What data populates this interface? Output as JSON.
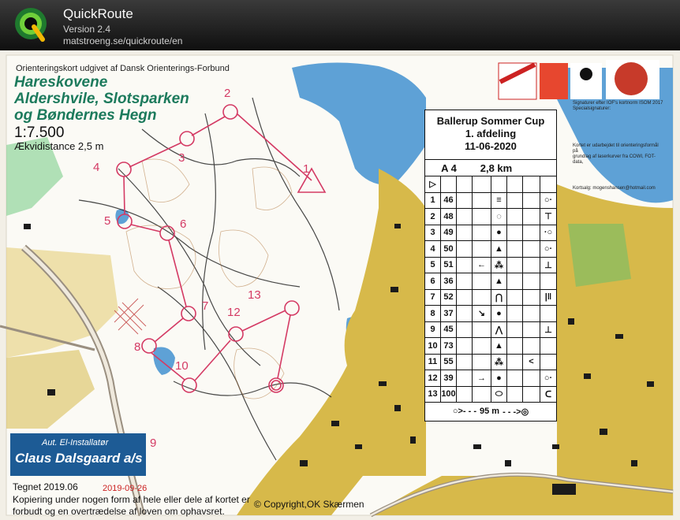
{
  "app": {
    "name": "QuickRoute",
    "version": "Version 2.4",
    "url": "matstroeng.se/quickroute/en",
    "logo_letter": "Q"
  },
  "map": {
    "publisher": "Orienteringskort udgivet af Dansk Orienterings-Forbund",
    "title_lines": [
      "Hareskovene",
      "Aldershvile, Slotsparken",
      "og Bøndernes Hegn"
    ],
    "scale": "1:7.500",
    "contour": "Ækvidistance 2,5 m",
    "control_numbers": [
      "2",
      "3",
      "4",
      "5",
      "6",
      "7",
      "8",
      "9",
      "10",
      "12",
      "13",
      "1"
    ],
    "description_card": {
      "title": "Ballerup Sommer Cup",
      "subtitle": "1. afdeling",
      "date": "11-06-2020",
      "class": "A 4",
      "length": "2,8 km",
      "start_symbol": "▷",
      "rows": [
        {
          "n": "1",
          "code": "46",
          "dir": "",
          "feature": "≡",
          "detail": "",
          "extra": "○·"
        },
        {
          "n": "2",
          "code": "48",
          "dir": "",
          "feature": "◌",
          "detail": "",
          "extra": "⊤"
        },
        {
          "n": "3",
          "code": "49",
          "dir": "",
          "feature": "●",
          "detail": "",
          "extra": "·○"
        },
        {
          "n": "4",
          "code": "50",
          "dir": "",
          "feature": "▲",
          "detail": "",
          "extra": "○·"
        },
        {
          "n": "5",
          "code": "51",
          "dir": "←",
          "feature": "⁂",
          "detail": "",
          "extra": "⊥"
        },
        {
          "n": "6",
          "code": "36",
          "dir": "",
          "feature": "▲",
          "detail": "",
          "extra": ""
        },
        {
          "n": "7",
          "code": "52",
          "dir": "",
          "feature": "⋂",
          "detail": "",
          "extra": "|‖"
        },
        {
          "n": "8",
          "code": "37",
          "dir": "↘",
          "feature": "●",
          "detail": "",
          "extra": ""
        },
        {
          "n": "9",
          "code": "45",
          "dir": "",
          "feature": "⋀",
          "detail": "",
          "extra": "⊥"
        },
        {
          "n": "10",
          "code": "73",
          "dir": "",
          "feature": "▲",
          "detail": "",
          "extra": ""
        },
        {
          "n": "11",
          "code": "55",
          "dir": "",
          "feature": "⁂",
          "detail": "<",
          "extra": ""
        },
        {
          "n": "12",
          "code": "39",
          "dir": "→",
          "feature": "●",
          "detail": "",
          "extra": "○·"
        },
        {
          "n": "13",
          "code": "100",
          "dir": "",
          "feature": "⬭",
          "detail": "",
          "extra": "ᑕ"
        }
      ],
      "finish": "95 m"
    },
    "sponsor": {
      "top": "Aut. El-Installatør",
      "name": "Claus Dalsgaard a/s"
    },
    "drawn": "Tegnet 2019.06",
    "date": "2019-09-26",
    "copy_line_1": "Kopiering under nogen form af hele eller dele af kortet er",
    "copy_line_2": "forbudt og en overtrædelse af loven om ophavsret.",
    "copyright": "Copyright,OK Skærmen",
    "legend_lines": [
      "Signaturer efter IOF's kortnorm ISOM 2017",
      "Specialsignaturer:",
      "Kortet er udarbejdet til orienteringsformål på",
      "grundlag af laserkurver fra COWI, FOT-data,",
      "Kortsalg: mogenshansen@hotmail.com"
    ],
    "colors": {
      "water": "#5ea1d6",
      "urban": "#d7b94a",
      "forest": "#ffffff",
      "course": "#d43a64",
      "title_green": "#1c7a5c"
    }
  }
}
